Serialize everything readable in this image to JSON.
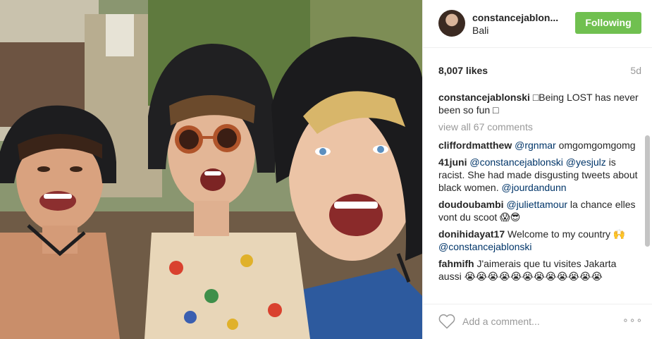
{
  "header": {
    "username": "constancejablon...",
    "location": "Bali",
    "follow_label": "Following",
    "follow_color": "#70c050"
  },
  "stats": {
    "likes": "8,007 likes",
    "age": "5d"
  },
  "caption": {
    "user": "constancejablonski",
    "text": "□Being LOST has never been so fun □"
  },
  "view_all": "view all 67 comments",
  "comments": [
    {
      "user": "cliffordmatthew",
      "parts": [
        {
          "mention": "@rgnmar"
        },
        {
          "text": " omgomgomgomg"
        }
      ]
    },
    {
      "user": "41juni",
      "parts": [
        {
          "mention": "@constancejablonski"
        },
        {
          "text": " "
        },
        {
          "mention": "@yesjulz"
        },
        {
          "text": " is racist. She had made disgusting tweets about black women. "
        },
        {
          "mention": "@jourdandunn"
        }
      ]
    },
    {
      "user": "doudoubambi",
      "parts": [
        {
          "mention": "@juliettamour"
        },
        {
          "text": " la chance elles vont du scoot 😱😎"
        }
      ]
    },
    {
      "user": "donihidayat17",
      "parts": [
        {
          "text": "Welcome to my country 🙌 "
        },
        {
          "mention": "@constancejablonski"
        }
      ]
    },
    {
      "user": "fahmifh",
      "parts": [
        {
          "text": "J'aimerais que tu visites Jakarta aussi 😭😭😭😭😭😭😭😭😭😭😭😭"
        }
      ]
    }
  ],
  "footer": {
    "placeholder": "Add a comment...",
    "more": "∘∘∘"
  },
  "icons": {
    "like": "heart-outline-icon",
    "more": "more-options-icon"
  },
  "colors": {
    "mention": "#003569",
    "muted": "#999999"
  }
}
